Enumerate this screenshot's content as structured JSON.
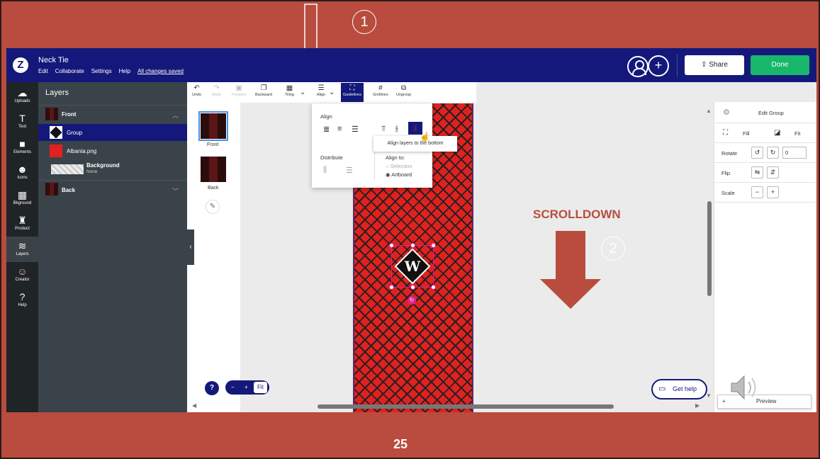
{
  "app": {
    "logo": "Z",
    "doc_title": "Neck Tie",
    "menu": [
      "Edit",
      "Collaborate",
      "Settings",
      "Help"
    ],
    "save_status": "All changes saved",
    "share_label": "Share",
    "done_label": "Done"
  },
  "icon_sidebar": [
    {
      "label": "Uploads",
      "icon": "upload-icon",
      "glyph": "☁"
    },
    {
      "label": "Text",
      "icon": "text-icon",
      "glyph": "T"
    },
    {
      "label": "Elements",
      "icon": "elements-icon",
      "glyph": "■"
    },
    {
      "label": "Icons",
      "icon": "smiley-icon",
      "glyph": "☻"
    },
    {
      "label": "Bkground",
      "icon": "background-icon",
      "glyph": "▦"
    },
    {
      "label": "Product",
      "icon": "product-icon",
      "glyph": "♜"
    },
    {
      "label": "Layers",
      "icon": "layers-icon",
      "glyph": "≋"
    },
    {
      "label": "Creator",
      "icon": "creator-avatar-icon",
      "glyph": "☺"
    },
    {
      "label": "Help",
      "icon": "help-icon",
      "glyph": "?"
    }
  ],
  "layers_panel": {
    "title": "Layers",
    "front_label": "Front",
    "group_label": "Group",
    "image_label": "Albania.png",
    "background_label": "Background",
    "background_value": "None",
    "back_label": "Back"
  },
  "toolbar": {
    "undo": "Undo",
    "redo": "Redo",
    "forward": "Forward",
    "backward": "Backward",
    "tiling": "Tiling",
    "align": "Align",
    "guidelines": "Guidelines",
    "gridlines": "Gridlines",
    "ungroup": "Ungroup"
  },
  "pages": {
    "front": "Front",
    "back": "Back"
  },
  "align_menu": {
    "title": "Align",
    "distribute": "Distribute",
    "align_to": "Align to:",
    "option_selection": "Selection",
    "option_artboard": "Artboard",
    "tooltip": "Align layers to the bottom"
  },
  "design_letter": "W",
  "right_panel": {
    "edit_group": "Edit Group",
    "fill": "Fill",
    "fit": "Fit",
    "rotate": "Rotate",
    "rotate_value": "0",
    "flip": "Flip",
    "scale": "Scale"
  },
  "zoom": {
    "minus": "−",
    "plus": "+",
    "fit": "Fit"
  },
  "get_help": "Get help",
  "preview": {
    "plus": "+",
    "label": "Preview"
  },
  "annotations": {
    "step1": "1",
    "step2": "2",
    "scroll_text": "SCROLLDOWN",
    "slide_number": "25"
  },
  "colors": {
    "slide_bg": "#b94c3e",
    "topbar": "#14187a",
    "done_green": "#18b76b",
    "tie_red": "#e1211f"
  }
}
